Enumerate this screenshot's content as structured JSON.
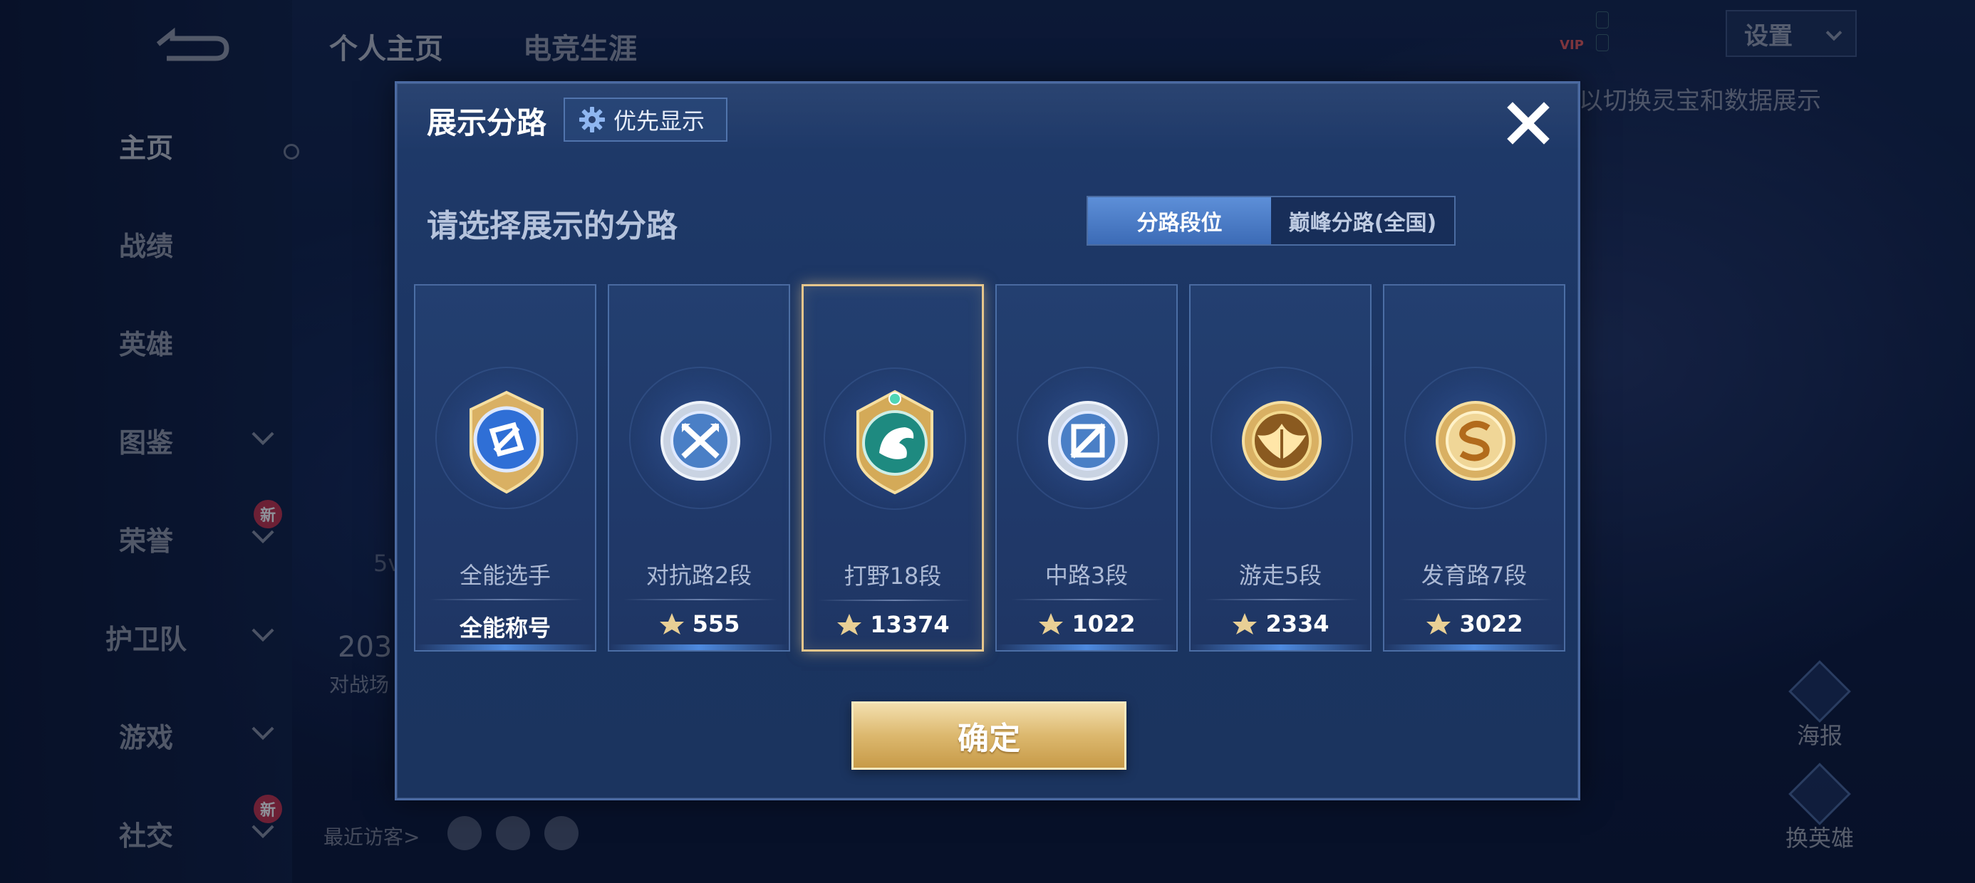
{
  "background": {
    "top_tabs": [
      "个人主页",
      "电竞生涯"
    ],
    "side_nav": [
      {
        "label": "主页",
        "chevron": false,
        "badge": ""
      },
      {
        "label": "战绩",
        "chevron": false,
        "badge": ""
      },
      {
        "label": "英雄",
        "chevron": false,
        "badge": ""
      },
      {
        "label": "图鉴",
        "chevron": true,
        "badge": ""
      },
      {
        "label": "荣誉",
        "chevron": true,
        "badge": "新"
      },
      {
        "label": "护卫队",
        "chevron": true,
        "badge": ""
      },
      {
        "label": "游戏",
        "chevron": true,
        "badge": ""
      },
      {
        "label": "社交",
        "chevron": true,
        "badge": "新"
      }
    ],
    "settings_label": "设置",
    "vip_label": "VIP",
    "hint_text": "以切换灵宝和数据展示",
    "poster_label": "海报",
    "switch_hero_label": "换英雄",
    "recent_visitors_label": "最近访客>",
    "stat_value": "203",
    "stat_caption": "对战场",
    "stat_5v": "5v"
  },
  "dialog": {
    "title": "展示分路",
    "priority_label": "优先显示",
    "subtitle": "请选择展示的分路",
    "segments": [
      {
        "label": "分路段位",
        "active": true
      },
      {
        "label": "巅峰分路(全国)",
        "active": false
      }
    ],
    "cards": [
      {
        "name": "全能选手",
        "value": "全能称号",
        "show_icon": false,
        "selected": false,
        "emblem": "all-round-emblem-icon"
      },
      {
        "name": "对抗路2段",
        "value": "555",
        "show_icon": true,
        "selected": false,
        "emblem": "clash-lane-emblem-icon"
      },
      {
        "name": "打野18段",
        "value": "13374",
        "show_icon": true,
        "selected": true,
        "emblem": "jungle-emblem-icon"
      },
      {
        "name": "中路3段",
        "value": "1022",
        "show_icon": true,
        "selected": false,
        "emblem": "mid-lane-emblem-icon"
      },
      {
        "name": "游走5段",
        "value": "2334",
        "show_icon": true,
        "selected": false,
        "emblem": "roam-emblem-icon"
      },
      {
        "name": "发育路7段",
        "value": "3022",
        "show_icon": true,
        "selected": false,
        "emblem": "farm-lane-emblem-icon"
      }
    ],
    "confirm_label": "确定"
  },
  "colors": {
    "accent_gold": "#e6c68c",
    "dialog_bg": "#1f3a6a",
    "segment_active": "#4f80cc"
  }
}
